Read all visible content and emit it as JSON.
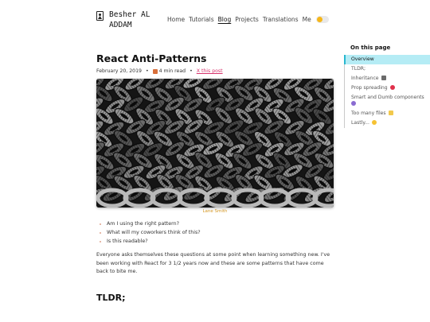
{
  "header": {
    "logo_text": "Besher AL ADDAM",
    "logo_icon": "portrait-icon",
    "nav": [
      {
        "label": "Home",
        "active": false
      },
      {
        "label": "Tutorials",
        "active": false
      },
      {
        "label": "Blog",
        "active": true
      },
      {
        "label": "Projects",
        "active": false
      },
      {
        "label": "Translations",
        "active": false
      },
      {
        "label": "Me",
        "active": false
      }
    ],
    "theme_toggle_icon": "sun-icon"
  },
  "article": {
    "title": "React Anti-Patterns",
    "date": "February 20, 2019",
    "read_time": "4 min read",
    "xpost": "X this post",
    "image_caption": "Lane Smith",
    "bullets": [
      "Am I using the right pattern?",
      "What will my coworkers think of this?",
      "Is this readable?"
    ],
    "paragraph": "Everyone asks themselves these questions at some point when learning something new. I've been working with React for 3 1/2 years now and these are some patterns that have come back to bite me.",
    "section_heading": "TLDR;"
  },
  "toc": {
    "title": "On this page",
    "items": [
      {
        "label": "Overview",
        "active": true,
        "emoji": ""
      },
      {
        "label": "TLDR;",
        "active": false,
        "emoji": ""
      },
      {
        "label": "Inheritance",
        "active": false,
        "emoji": "family-emoji"
      },
      {
        "label": "Prop spreading",
        "active": false,
        "emoji": "broken-heart-emoji"
      },
      {
        "label": "Smart and Dumb components",
        "active": false,
        "emoji": "theater-masks-emoji"
      },
      {
        "label": "Too many files",
        "active": false,
        "emoji": "folder-emoji"
      },
      {
        "label": "Lastly...",
        "active": false,
        "emoji": "thinking-emoji"
      }
    ]
  },
  "colors": {
    "accent_pink": "#d6336c",
    "caption_gold": "#d79a26",
    "toc_active_bg": "#b5ecf5",
    "toggle_sun": "#f6b619"
  }
}
